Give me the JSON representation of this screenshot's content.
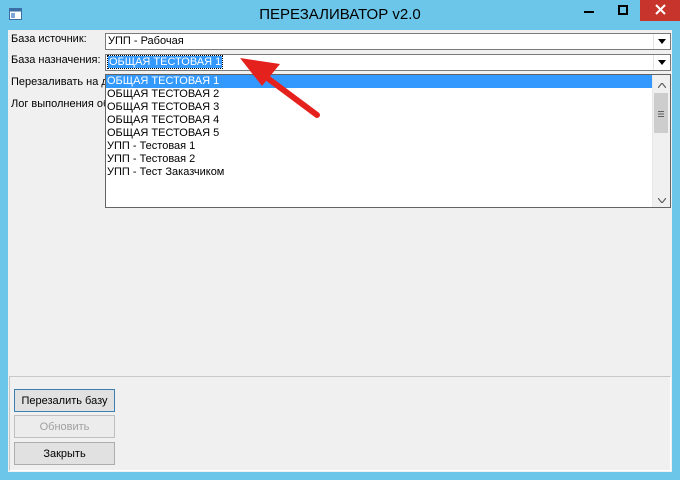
{
  "window": {
    "title": "ПЕРЕЗАЛИВАТОР v2.0",
    "accent": "#6bc6ea",
    "close_color": "#c7342b"
  },
  "form": {
    "source_label": "База источник:",
    "source_value": "УПП - Рабочая",
    "target_label": "База назначения:",
    "target_value": "ОБЩАЯ ТЕСТОВАЯ 1",
    "date_label": "Перезаливать на д",
    "log_label": "Лог выполнения об"
  },
  "dropdown": {
    "items": [
      "ОБЩАЯ ТЕСТОВАЯ 1",
      "ОБЩАЯ ТЕСТОВАЯ 2",
      "ОБЩАЯ ТЕСТОВАЯ 3",
      "ОБЩАЯ ТЕСТОВАЯ 4",
      "ОБЩАЯ ТЕСТОВАЯ 5",
      "УПП - Тестовая 1",
      "УПП - Тестовая 2",
      "УПП - Тест Заказчиком"
    ],
    "highlighted_index": 0
  },
  "buttons": {
    "reload": "Перезалить базу",
    "refresh": "Обновить",
    "close": "Закрыть"
  },
  "annotation": {
    "arrow_color": "#e5211d"
  }
}
